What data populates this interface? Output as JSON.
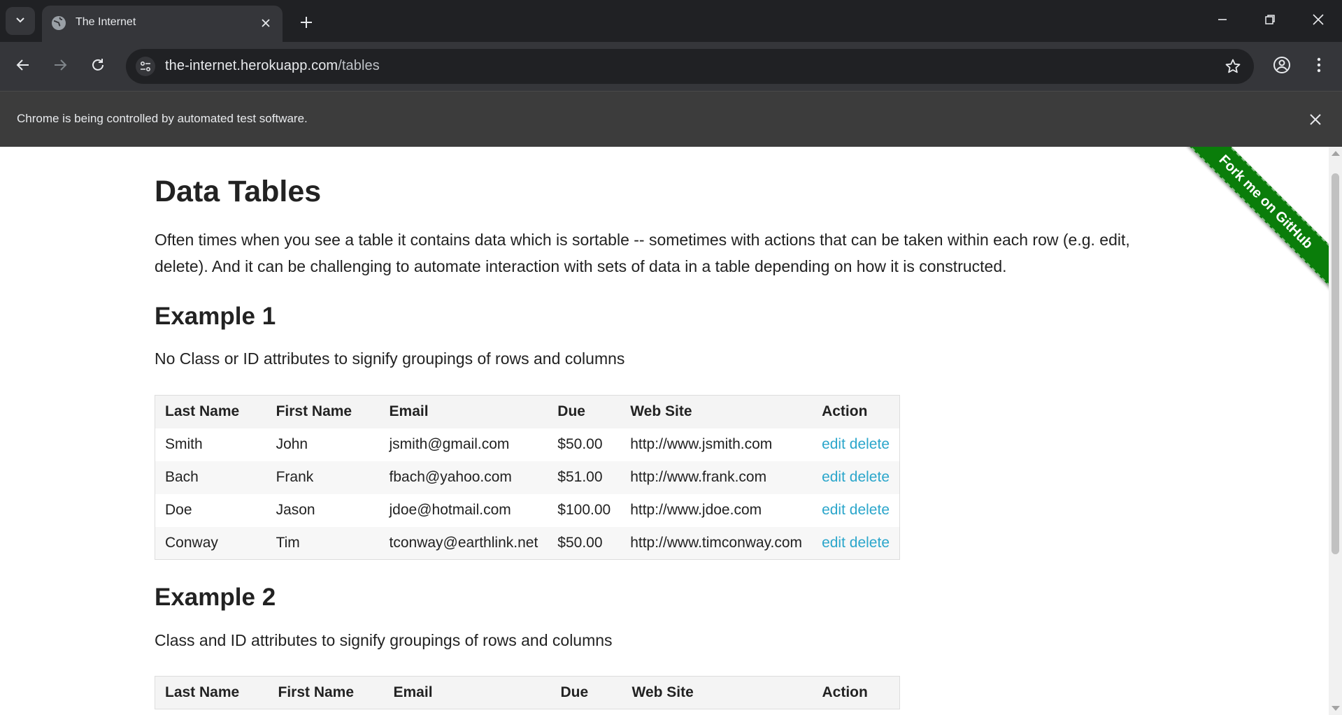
{
  "browser": {
    "tab": {
      "title": "The Internet"
    },
    "omnibox": {
      "host": "the-internet.herokuapp.com",
      "path": "/tables"
    },
    "infobar": {
      "message": "Chrome is being controlled by automated test software."
    }
  },
  "page": {
    "title": "Data Tables",
    "intro": "Often times when you see a table it contains data which is sortable -- sometimes with actions that can be taken within each row (e.g. edit, delete). And it can be challenging to automate interaction with sets of data in a table depending on how it is constructed.",
    "ribbon": "Fork me on GitHub",
    "columns": [
      "Last Name",
      "First Name",
      "Email",
      "Due",
      "Web Site",
      "Action"
    ],
    "example1": {
      "heading": "Example 1",
      "description": "No Class or ID attributes to signify groupings of rows and columns",
      "rows": [
        {
          "last": "Smith",
          "first": "John",
          "email": "jsmith@gmail.com",
          "due": "$50.00",
          "web": "http://www.jsmith.com",
          "edit": "edit",
          "delete": "delete"
        },
        {
          "last": "Bach",
          "first": "Frank",
          "email": "fbach@yahoo.com",
          "due": "$51.00",
          "web": "http://www.frank.com",
          "edit": "edit",
          "delete": "delete"
        },
        {
          "last": "Doe",
          "first": "Jason",
          "email": "jdoe@hotmail.com",
          "due": "$100.00",
          "web": "http://www.jdoe.com",
          "edit": "edit",
          "delete": "delete"
        },
        {
          "last": "Conway",
          "first": "Tim",
          "email": "tconway@earthlink.net",
          "due": "$50.00",
          "web": "http://www.timconway.com",
          "edit": "edit",
          "delete": "delete"
        }
      ]
    },
    "example2": {
      "heading": "Example 2",
      "description": "Class and ID attributes to signify groupings of rows and columns"
    }
  },
  "colors": {
    "link": "#2ba6cb",
    "ribbon": "#0a7d0a",
    "chrome_dark": "#202124",
    "chrome_toolbar": "#35363a"
  }
}
